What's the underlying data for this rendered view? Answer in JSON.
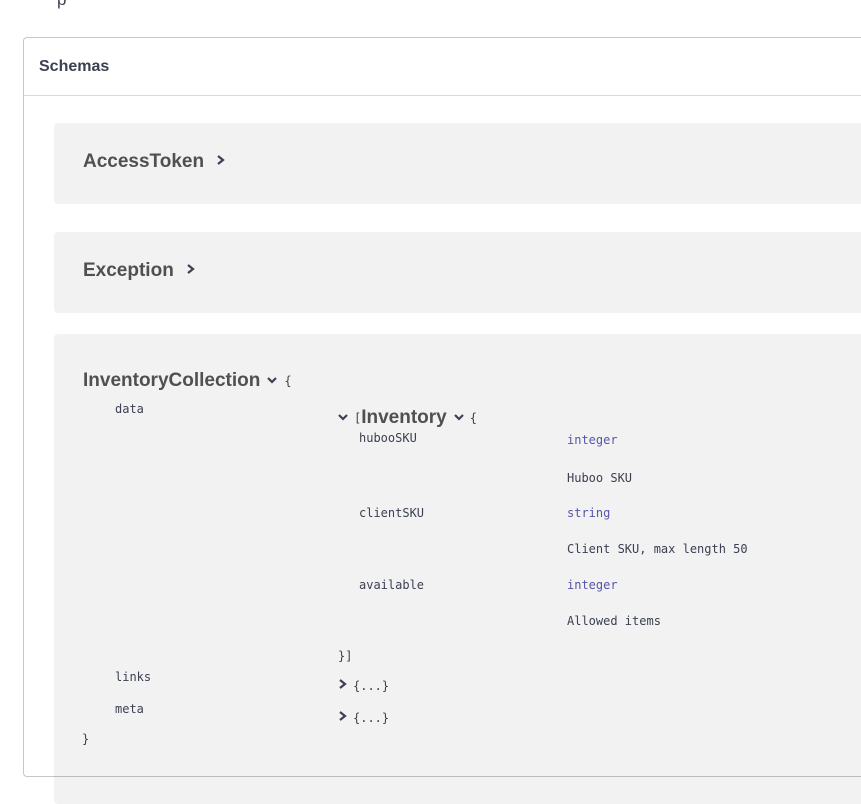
{
  "schemas": {
    "title": "Schemas",
    "models": [
      {
        "name": "AccessToken",
        "expanded": false
      },
      {
        "name": "Exception",
        "expanded": false
      },
      {
        "name": "InventoryCollection",
        "expanded": true,
        "open_brace": "{",
        "close_brace": "}",
        "properties": {
          "data": {
            "name": "data",
            "array_open": "[",
            "array_close": "}]",
            "model_name": "Inventory",
            "model_open": "{",
            "fields": [
              {
                "name": "hubooSKU",
                "type": "integer",
                "description": "Huboo SKU"
              },
              {
                "name": "clientSKU",
                "type": "string",
                "description": "Client SKU, max length 50"
              },
              {
                "name": "available",
                "type": "integer",
                "description": "Allowed items"
              }
            ]
          },
          "links": {
            "name": "links",
            "collapsed_value": "{...}"
          },
          "meta": {
            "name": "meta",
            "collapsed_value": "{...}"
          }
        }
      }
    ]
  },
  "icons": {
    "collapsed": "chevron-right-icon",
    "expanded": "chevron-down-icon"
  },
  "colors": {
    "type": "#5555aa",
    "text": "#3b4151",
    "model_title": "#505050"
  }
}
